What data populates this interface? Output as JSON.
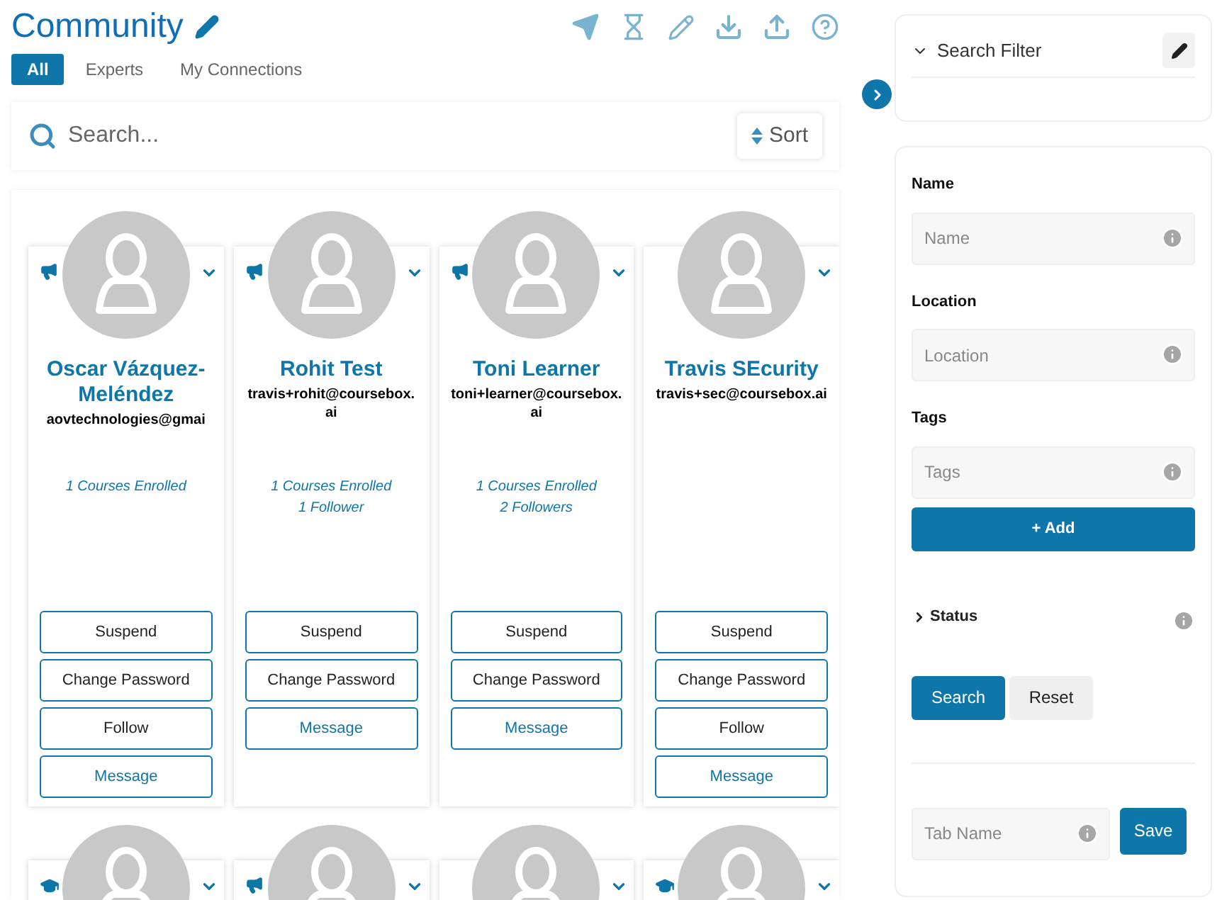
{
  "header": {
    "title": "Community"
  },
  "tabs": [
    {
      "label": "All",
      "selected": true
    },
    {
      "label": "Experts",
      "selected": false
    },
    {
      "label": "My Connections",
      "selected": false
    }
  ],
  "search": {
    "placeholder": "Search...",
    "sort_label": "Sort"
  },
  "cards": [
    {
      "kind": "megaphone",
      "name": "Oscar Vázquez-Meléndez",
      "email": "aovtechnologies@gmai",
      "stats": [
        "1 Courses Enrolled"
      ],
      "buttons": [
        {
          "label": "Suspend",
          "kind": "plain"
        },
        {
          "label": "Change Password",
          "kind": "plain"
        },
        {
          "label": "Follow",
          "kind": "plain"
        },
        {
          "label": "Message",
          "kind": "message"
        }
      ]
    },
    {
      "kind": "megaphone",
      "name": "Rohit Test",
      "email": "travis+rohit@coursebox.ai",
      "stats": [
        "1 Courses Enrolled",
        "1 Follower"
      ],
      "buttons": [
        {
          "label": "Suspend",
          "kind": "plain"
        },
        {
          "label": "Change Password",
          "kind": "plain"
        },
        {
          "label": "Message",
          "kind": "message"
        }
      ]
    },
    {
      "kind": "megaphone",
      "name": "Toni Learner",
      "email": "toni+learner@coursebox.ai",
      "stats": [
        "1 Courses Enrolled",
        "2 Followers"
      ],
      "buttons": [
        {
          "label": "Suspend",
          "kind": "plain"
        },
        {
          "label": "Change Password",
          "kind": "plain"
        },
        {
          "label": "Message",
          "kind": "message"
        }
      ]
    },
    {
      "name": "Travis SEcurity",
      "email": "travis+sec@coursebox.ai",
      "buttons": [
        {
          "label": "Suspend",
          "kind": "plain"
        },
        {
          "label": "Change Password",
          "kind": "plain"
        },
        {
          "label": "Follow",
          "kind": "plain"
        },
        {
          "label": "Message",
          "kind": "message"
        }
      ]
    }
  ],
  "more_cards": [
    {
      "kind": "cap"
    },
    {
      "kind": "megaphone"
    },
    {
      "kind": "plain"
    },
    {
      "kind": "cap"
    }
  ],
  "filter": {
    "title": "Search Filter",
    "expanded": true
  },
  "fields": [
    {
      "label": "Name",
      "placeholder": "Name"
    },
    {
      "label": "Location",
      "placeholder": "Location"
    },
    {
      "label": "Tags",
      "placeholder": "Tags"
    }
  ],
  "add_button": "+ Add",
  "status": {
    "label": "Status",
    "expanded": false
  },
  "search_button": "Search",
  "reset_button": "Reset",
  "tab_name": {
    "placeholder": "Tab Name",
    "save": "Save"
  }
}
